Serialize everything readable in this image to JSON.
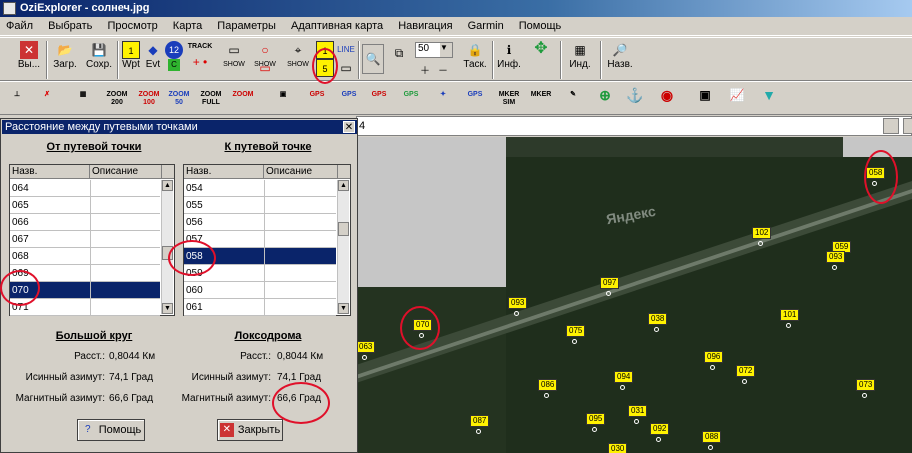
{
  "window": {
    "title": "OziExplorer - солнеч.jpg"
  },
  "menu": [
    "Файл",
    "Выбрать",
    "Просмотр",
    "Карта",
    "Параметры",
    "Адаптивная карта",
    "Навигация",
    "Garmin",
    "Помощь"
  ],
  "toolbar1": {
    "exit": "Вы...",
    "load": "Загр.",
    "save": "Сохр.",
    "wpt": "Wpt",
    "evt": "Evt",
    "track": "TRACK",
    "zoom_value": "50",
    "task": "Таск.",
    "info": "Инф.",
    "ind": "Инд.",
    "name": "Назв."
  },
  "toolbar2": {
    "zoom200": "ZOOM 200",
    "zoom100": "ZOOM 100",
    "zoom50": "ZOOM 50",
    "zoomfull": "ZOOM FULL",
    "zoom": "ZOOM",
    "mrksim": "MKER SIM",
    "mrk": "MKER"
  },
  "address": {
    "page": "4"
  },
  "dialog": {
    "title": "Расстояние между путевыми точками",
    "from_header": "От путевой точки",
    "to_header": "К путевой точке",
    "col_name": "Назв.",
    "col_desc": "Описание",
    "from_list": [
      "064",
      "065",
      "066",
      "067",
      "068",
      "069",
      "070",
      "071"
    ],
    "from_selected": "070",
    "to_list": [
      "054",
      "055",
      "056",
      "057",
      "058",
      "059",
      "060",
      "061"
    ],
    "to_selected": "058",
    "great_circle": "Большой круг",
    "loxodrome": "Локсодрома",
    "dist_label": "Расст.:",
    "true_az_label": "Исинный азимут:",
    "mag_az_label": "Магнитный азимут:",
    "gc_dist": "0,8044 Км",
    "gc_true": "74,1 Град",
    "gc_mag": "66,6 Град",
    "lx_dist": "0,8044 Км",
    "lx_true": "74,1 Град",
    "lx_mag": "66,6 Град",
    "help_button": "Помощь",
    "close_button": "Закрыть"
  },
  "map": {
    "watermark": "Яндекс",
    "waypoints": [
      "058",
      "102",
      "059",
      "093",
      "097",
      "093",
      "070",
      "038",
      "101",
      "063",
      "075",
      "096",
      "094",
      "072",
      "086",
      "073",
      "087",
      "095",
      "031",
      "092",
      "030",
      "088"
    ]
  },
  "colors": {
    "titlebar": "#0a246a",
    "waypoint": "#fff200",
    "annotation": "#e0102a"
  }
}
